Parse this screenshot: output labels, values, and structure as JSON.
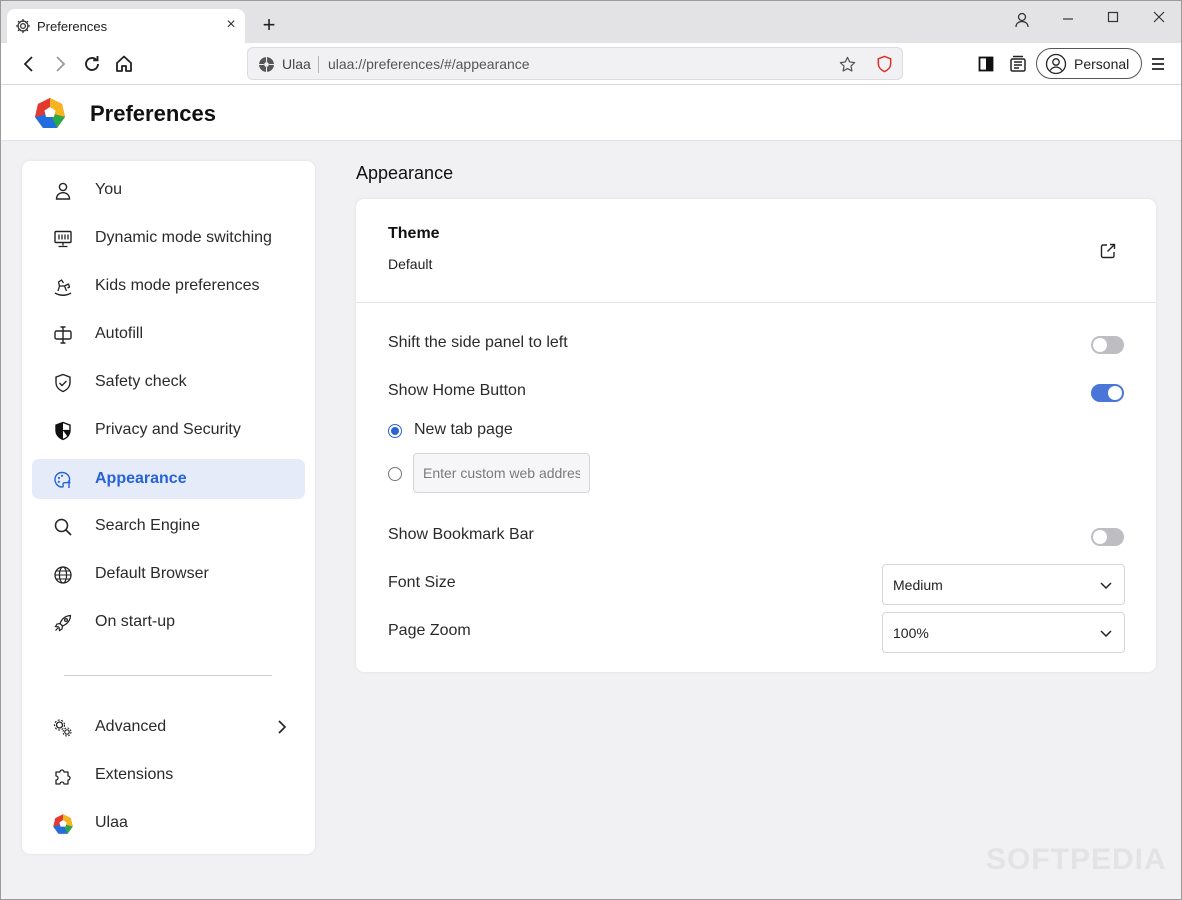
{
  "tab": {
    "title": "Preferences",
    "close": "×",
    "new_tab": "+"
  },
  "omnibox": {
    "site": "Ulaa",
    "url": "ulaa://preferences/#/appearance"
  },
  "profile": {
    "label": "Personal"
  },
  "header": {
    "title": "Preferences"
  },
  "sidebar": {
    "items": [
      {
        "label": "You",
        "icon": "person-icon"
      },
      {
        "label": "Dynamic mode switching",
        "icon": "monitor-icon"
      },
      {
        "label": "Kids mode preferences",
        "icon": "rocking-horse-icon"
      },
      {
        "label": "Autofill",
        "icon": "autofill-icon"
      },
      {
        "label": "Safety check",
        "icon": "shield-check-icon"
      },
      {
        "label": "Privacy and Security",
        "icon": "shield-icon"
      },
      {
        "label": "Appearance",
        "icon": "palette-icon",
        "active": true
      },
      {
        "label": "Search Engine",
        "icon": "search-icon"
      },
      {
        "label": "Default Browser",
        "icon": "globe-icon"
      },
      {
        "label": "On start-up",
        "icon": "rocket-icon"
      }
    ],
    "bottom": [
      {
        "label": "Advanced",
        "icon": "gears-icon"
      },
      {
        "label": "Extensions",
        "icon": "puzzle-icon"
      },
      {
        "label": "Ulaa",
        "icon": "ulaa-logo-icon"
      }
    ]
  },
  "main": {
    "title": "Appearance",
    "theme": {
      "title": "Theme",
      "value": "Default"
    },
    "settings": {
      "side_panel": {
        "label": "Shift the side panel to left",
        "enabled": false
      },
      "home_button": {
        "label": "Show Home Button",
        "enabled": true
      },
      "home_option_newtab": {
        "label": "New tab page",
        "selected": true
      },
      "home_option_custom": {
        "placeholder": "Enter custom web address",
        "selected": false
      },
      "bookmark_bar": {
        "label": "Show Bookmark Bar",
        "enabled": false
      },
      "font_size": {
        "label": "Font Size",
        "value": "Medium"
      },
      "page_zoom": {
        "label": "Page Zoom",
        "value": "100%"
      }
    }
  },
  "colors": {
    "accent": "#2563d6",
    "toggle_on": "#4a76d8",
    "active_bg": "#e6ebfa"
  },
  "watermark": "SOFTPEDIA"
}
